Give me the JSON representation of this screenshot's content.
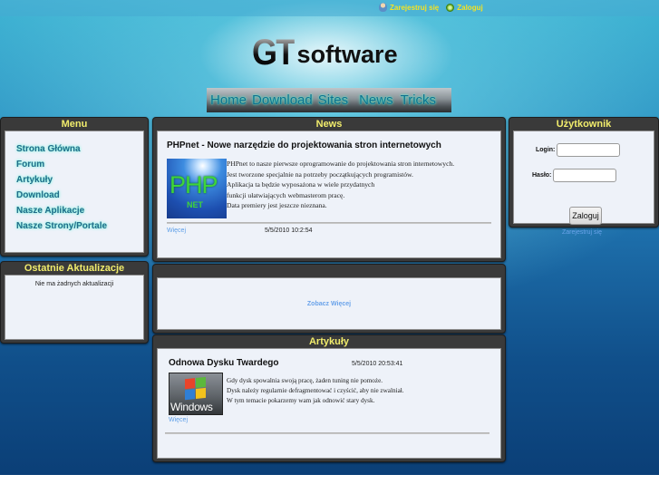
{
  "top_links": [
    {
      "label": "Zarejestruj się",
      "icon": "user-register-icon"
    },
    {
      "label": "Zaloguj",
      "icon": "login-icon"
    }
  ],
  "logo": {
    "gt": "GT",
    "software": "software"
  },
  "nav": [
    "Home",
    "Download",
    "Sites",
    "News",
    "Tricks"
  ],
  "menu": {
    "title": "Menu",
    "items": [
      "Strona Główna",
      "Forum",
      "Artykuły",
      "Download",
      "Nasze Aplikacje",
      "Nasze Strony/Portale"
    ]
  },
  "updates": {
    "title": "Ostatnie Aktualizacje",
    "empty_text": "Nie ma żadnych aktualizacji"
  },
  "news": {
    "title": "News",
    "item": {
      "headline": "PHPnet - Nowe narzędzie do projektowania stron internetowych",
      "image_text_main": "PHP",
      "image_text_sub": "NET",
      "lines": [
        "PHPnet to nasze pierwsze oprogramowanie do projektowania stron internetowych.",
        "Jest tworzone specjalnie na potrzeby początkujących programistów.",
        "Aplikacja ta będzie wyposażona w wiele przydatnych",
        "funkcji ułatwiających webmasterom pracę.",
        "Data premiery jest jeszcze nieznana."
      ],
      "more_label": "Więcej",
      "date": "5/5/2010 10:2:54"
    }
  },
  "see_more": {
    "label": "Zobacz Więcej"
  },
  "articles": {
    "title": "Artykuły",
    "item": {
      "headline": "Odnowa Dysku Twardego",
      "date": "5/5/2010 20:53:41",
      "image_text": "Windows",
      "lines": [
        "Gdy dysk spowalnia swoją pracę, żaden tuning nie pomoże.",
        "Dysk należy regularnie defragmentować i czyścić, aby nie zwalniał.",
        "W tym temacie pokarzemy wam jak odnowić stary dysk."
      ],
      "more_label": "Więcej"
    }
  },
  "user_panel": {
    "title": "Użytkownik",
    "login_label": "Login:",
    "login_value": "",
    "password_label": "Hasło:",
    "password_value": "",
    "submit_label": "Zaloguj",
    "register_label": "Zarejestruj się"
  }
}
